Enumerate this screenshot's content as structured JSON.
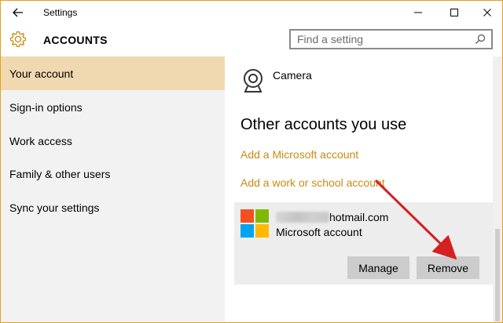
{
  "window": {
    "title": "Settings"
  },
  "header": {
    "title": "ACCOUNTS",
    "search_placeholder": "Find a setting"
  },
  "sidebar": {
    "items": [
      {
        "label": "Your account",
        "active": true
      },
      {
        "label": "Sign-in options",
        "active": false
      },
      {
        "label": "Work access",
        "active": false
      },
      {
        "label": "Family & other users",
        "active": false
      },
      {
        "label": "Sync your settings",
        "active": false
      }
    ]
  },
  "content": {
    "camera_label": "Camera",
    "section_title": "Other accounts you use",
    "links": {
      "add_microsoft": "Add a Microsoft account",
      "add_work": "Add a work or school account"
    },
    "account": {
      "email_visible": "hotmail.com",
      "type": "Microsoft account",
      "manage_label": "Manage",
      "remove_label": "Remove"
    }
  },
  "colors": {
    "accent": "#e3a21a",
    "link": "#c98b12",
    "active_nav": "#f0d9b1",
    "annotation_arrow": "#d42020",
    "ms_red": "#f25022",
    "ms_green": "#7fba00",
    "ms_blue": "#00a4ef",
    "ms_yellow": "#ffb900"
  },
  "icons": {
    "back": "back-arrow-icon",
    "gear": "gear-icon",
    "search": "search-icon",
    "camera": "camera-icon",
    "logo": "microsoft-logo-icon",
    "minimize": "minimize-icon",
    "maximize": "maximize-icon",
    "close": "close-icon"
  }
}
